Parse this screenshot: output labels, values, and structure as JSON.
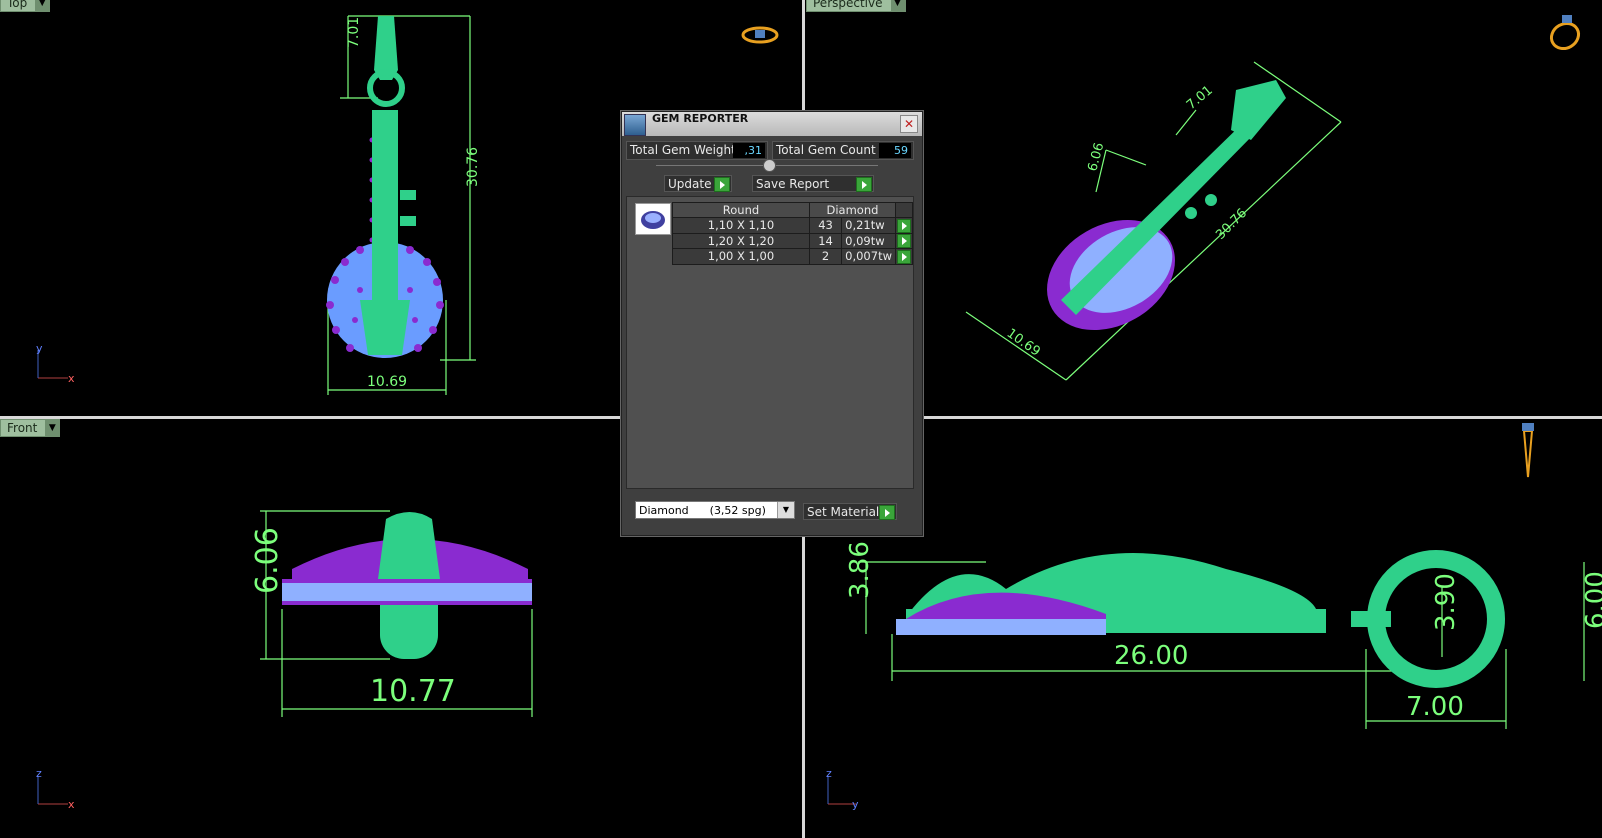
{
  "viewports": {
    "top_label": "Top",
    "perspective_label": "Perspective",
    "front_label": "Front",
    "top_dims": {
      "height_upper": "7.01",
      "height_total": "30.76",
      "width": "10.69"
    },
    "persp_dims": {
      "a": "7.01",
      "b": "6.06",
      "c": "30.76",
      "d": "10.69"
    },
    "front_dims": {
      "height": "6.06",
      "width": "10.77"
    },
    "right_dims": {
      "height_left": "3.86",
      "length": "26.00",
      "loop_inner": "3.90",
      "loop_height": "6.00",
      "loop_width": "7.00"
    },
    "axis_top": {
      "v": "y",
      "h": "x"
    },
    "axis_front": {
      "v": "z",
      "h": "x"
    },
    "axis_right": {
      "v": "z",
      "h": "y"
    }
  },
  "dialog": {
    "title": "GEM REPORTER",
    "total_weight_label": "Total Gem Weight",
    "total_weight_value": ",31",
    "total_count_label": "Total Gem Count",
    "total_count_value": "59",
    "update_label": "Update",
    "save_report_label": "Save Report",
    "table_headers": [
      "Round",
      "Diamond"
    ],
    "rows": [
      {
        "size": "1,10 X 1,10",
        "count": "43",
        "weight": "0,21tw"
      },
      {
        "size": "1,20 X 1,20",
        "count": "14",
        "weight": "0,09tw"
      },
      {
        "size": "1,00 X 1,00",
        "count": "2",
        "weight": "0,007tw"
      }
    ],
    "material_select": "Diamond      (3,52 spg)",
    "set_material_label": "Set Material"
  },
  "colors": {
    "model": "#2fd08a",
    "gems_purple": "#8a2bd0",
    "gems_blue": "#8fb0ff",
    "dims": "#7cff7c"
  }
}
